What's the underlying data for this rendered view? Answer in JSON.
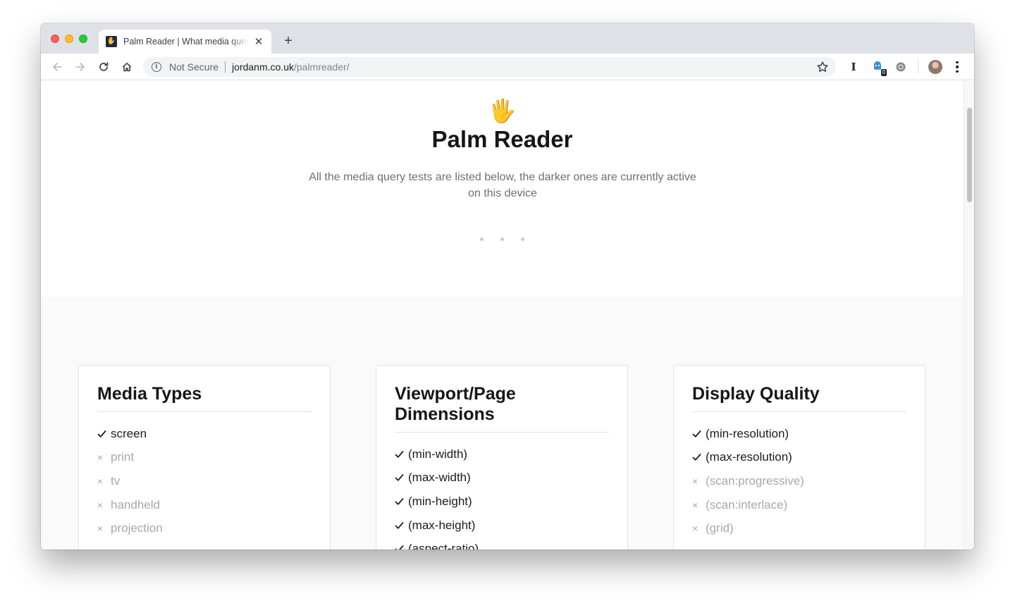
{
  "browser": {
    "tab_title": "Palm Reader | What media queries are active",
    "tab_favicon": "✋",
    "new_tab_label": "+",
    "security_label": "Not Secure",
    "url_host": "jordanm.co.uk",
    "url_path": "/palmreader/",
    "extension_badge": "0",
    "extension_i_label": "I"
  },
  "page": {
    "hero_icon": "🖐",
    "title": "Palm Reader",
    "description": "All the media query tests are listed below, the darker ones are currently active on this device"
  },
  "cards": [
    {
      "title": "Media Types",
      "items": [
        {
          "label": "screen",
          "active": true
        },
        {
          "label": "print",
          "active": false
        },
        {
          "label": "tv",
          "active": false
        },
        {
          "label": "handheld",
          "active": false
        },
        {
          "label": "projection",
          "active": false
        }
      ]
    },
    {
      "title": "Viewport/Page Dimensions",
      "items": [
        {
          "label": "(min-width)",
          "active": true
        },
        {
          "label": "(max-width)",
          "active": true
        },
        {
          "label": "(min-height)",
          "active": true
        },
        {
          "label": "(max-height)",
          "active": true
        },
        {
          "label": "(aspect-ratio)",
          "active": true
        }
      ]
    },
    {
      "title": "Display Quality",
      "items": [
        {
          "label": "(min-resolution)",
          "active": true
        },
        {
          "label": "(max-resolution)",
          "active": true
        },
        {
          "label": "(scan:progressive)",
          "active": false
        },
        {
          "label": "(scan:interlace)",
          "active": false
        },
        {
          "label": "(grid)",
          "active": false
        }
      ]
    }
  ],
  "icons": {
    "back": "arrow-left-icon",
    "forward": "arrow-right-icon",
    "reload": "reload-icon",
    "home": "home-icon",
    "bookmark": "star-icon",
    "check": "check-icon",
    "cross": "cross-icon"
  }
}
